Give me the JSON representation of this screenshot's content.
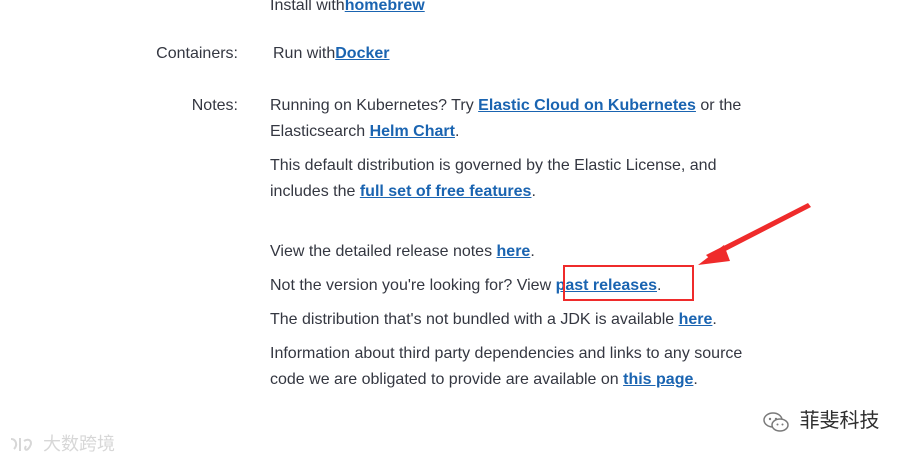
{
  "top_row": {
    "text": "Install with",
    "link": "homebrew"
  },
  "containers": {
    "label": "Containers:",
    "text": "Run with",
    "link": "Docker"
  },
  "notes": {
    "label": "Notes:",
    "p1": {
      "text1": "Running on Kubernetes? Try ",
      "link1": "Elastic Cloud on Kubernetes",
      "text2": " or the Elasticsearch ",
      "link2": "Helm Chart",
      "text3": "."
    },
    "p2": {
      "text1": "This default distribution is governed by the Elastic License, and includes the ",
      "link1": "full set of free features",
      "text2": "."
    },
    "p3": {
      "text1": "View the detailed release notes ",
      "link1": "here",
      "text2": "."
    },
    "p4": {
      "text1": "Not the version you're looking for? View ",
      "link1": "past releases",
      "text2": "."
    },
    "p5": {
      "text1": "The distribution that's not bundled with a JDK is available ",
      "link1": "here",
      "text2": "."
    },
    "p6": {
      "text1": "Information about third party dependencies and links to any source code we are obligated to provide are available on ",
      "link1": "this page",
      "text2": "."
    }
  },
  "annotation": {
    "color": "#ef2b2b"
  },
  "watermarks": {
    "left": "大数跨境",
    "right": "菲斐科技"
  },
  "colors": {
    "link": "#1a64b1",
    "text": "#343741"
  }
}
